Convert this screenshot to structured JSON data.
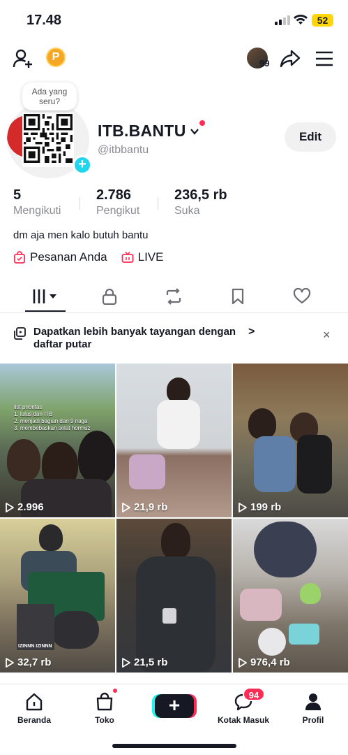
{
  "status": {
    "time": "17.48",
    "battery": "52"
  },
  "topbar": {
    "story_count": "99",
    "coin_letter": "P"
  },
  "profile": {
    "bubble": "Ada yang seru?",
    "name": "ITB.BANTU",
    "handle": "@itbbantu",
    "edit_label": "Edit",
    "bio": "dm aja men kalo butuh bantu"
  },
  "stats": [
    {
      "value": "5",
      "label": "Mengikuti"
    },
    {
      "value": "2.786",
      "label": "Pengikut"
    },
    {
      "value": "236,5 rb",
      "label": "Suka"
    }
  ],
  "links": {
    "orders": "Pesanan Anda",
    "live": "LIVE"
  },
  "banner": {
    "text": "Dapatkan lebih banyak tayangan dengan daftar putar",
    "chevron": ">",
    "close": "×"
  },
  "videos": [
    {
      "views": "2.996",
      "overlay": [
        "list prioritas",
        "1. lulus dari ITB",
        "2. menjadi bagian dari 9 naga",
        "3. membebaskan selat hormuz"
      ]
    },
    {
      "views": "21,9 rb"
    },
    {
      "views": "199 rb"
    },
    {
      "views": "32,7 rb",
      "caption": "IZINNN IZINNN"
    },
    {
      "views": "21,5 rb"
    },
    {
      "views": "976,4 rb"
    }
  ],
  "nav": {
    "home": "Beranda",
    "shop": "Toko",
    "create": "+",
    "inbox": "Kotak Masuk",
    "inbox_badge": "94",
    "profile": "Profil"
  },
  "colors": {
    "accent": "#fe2c55",
    "cyan": "#20d5ec",
    "coin": "#f5a623",
    "battery": "#ffd60a"
  }
}
